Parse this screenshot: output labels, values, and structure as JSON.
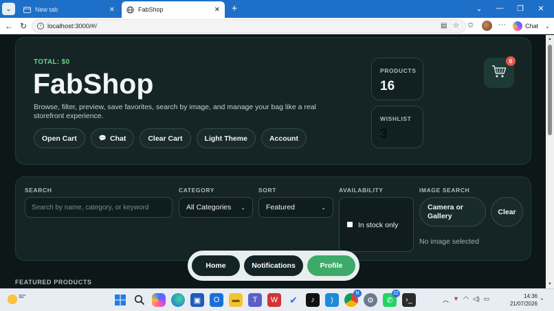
{
  "browser": {
    "tabs": [
      {
        "title": "New tab"
      },
      {
        "title": "FabShop"
      }
    ],
    "new_tab_glyph": "+",
    "url": "localhost:3000/#/",
    "chat_label": "Chat",
    "window_controls": {
      "minimize": "⌄",
      "min": "—",
      "restore": "❐",
      "close": "✕"
    }
  },
  "hero": {
    "total": "TOTAL: $0",
    "title": "FabShop",
    "description": "Browse, filter, preview, save favorites, search by image, and manage your bag like a real storefront experience.",
    "actions": [
      "Open Cart",
      "Chat",
      "Clear Cart",
      "Light Theme",
      "Account"
    ],
    "stats": {
      "products": {
        "label": "PRODUCTS",
        "value": "16"
      },
      "wishlist": {
        "label": "WISHLIST",
        "value": "3"
      }
    },
    "cart_count": "0"
  },
  "filters": {
    "search": {
      "label": "SEARCH",
      "placeholder": "Search by name, category, or keyword",
      "value": ""
    },
    "category": {
      "label": "CATEGORY",
      "selected": "All Categories"
    },
    "sort": {
      "label": "SORT",
      "selected": "Featured"
    },
    "availability": {
      "label": "AVAILABILITY",
      "option": "In stock only",
      "checked": false
    },
    "image_search": {
      "label": "IMAGE SEARCH",
      "camera_label": "Camera or Gallery",
      "clear_label": "Clear",
      "status": "No image selected"
    }
  },
  "sections": {
    "featured": "FEATURED PRODUCTS"
  },
  "bottom_nav": {
    "home": "Home",
    "notifications": "Notifications",
    "profile": "Profile",
    "active": "Profile"
  },
  "taskbar": {
    "temperature": "32°",
    "badges": {
      "chrome": "N",
      "whatsapp": "22"
    },
    "time": "14:36",
    "date": "21/07/2026"
  },
  "colors": {
    "accent_green": "#3daa6a",
    "total_green": "#6ed08a",
    "badge_red": "#e4574d",
    "browser_blue": "#1e6fc8"
  }
}
